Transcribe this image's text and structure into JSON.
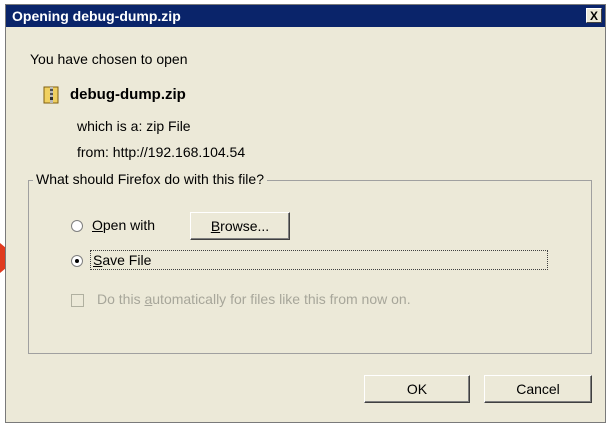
{
  "window": {
    "title": "Opening debug-dump.zip",
    "close_glyph": "X"
  },
  "info": {
    "intro": "You have chosen to open",
    "filename": "debug-dump.zip",
    "which_is": "which is a:  zip File",
    "from": "from:  http://192.168.104.54",
    "file_icon": "zip-file-icon"
  },
  "group": {
    "legend": "What should Firefox do with this file?",
    "open_with": {
      "prefix": "",
      "accel": "O",
      "rest": "pen with"
    },
    "browse": {
      "accel": "B",
      "rest": "rowse..."
    },
    "save_file": {
      "accel": "S",
      "rest": "ave File",
      "selected": true
    },
    "auto": {
      "prefix": "Do this ",
      "accel": "a",
      "rest": "utomatically for files like this from now on.",
      "enabled": false,
      "checked": false
    }
  },
  "buttons": {
    "ok": "OK",
    "cancel": "Cancel"
  },
  "colors": {
    "titlebar": "#0a246a",
    "dialog_bg": "#ece9d8",
    "arrow": "#e03a1e",
    "disabled_text": "#a7a69a"
  }
}
